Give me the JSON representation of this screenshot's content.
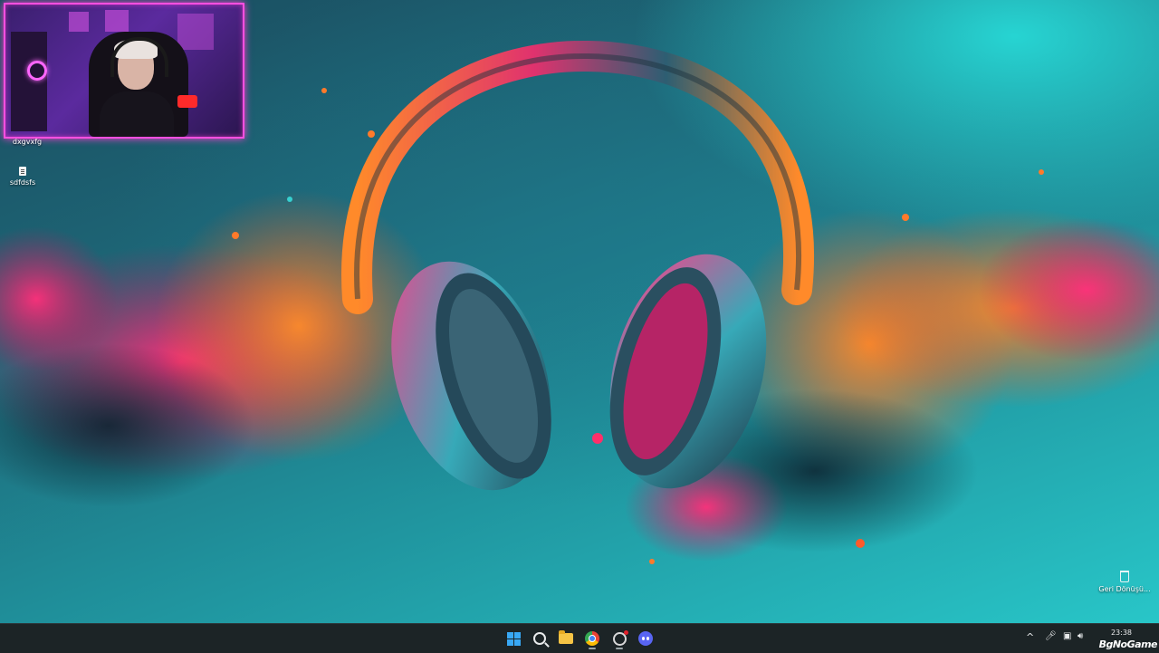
{
  "desktop": {
    "icons": [
      {
        "label": "dxgvxfg"
      },
      {
        "label": "sdfdsfs"
      }
    ],
    "recycle_bin": {
      "label": "Geri Dönüşü..."
    }
  },
  "taskbar": {
    "apps": [
      {
        "name": "start",
        "icon": "windows-icon"
      },
      {
        "name": "search",
        "icon": "search-icon"
      },
      {
        "name": "file-explorer",
        "icon": "folder-icon"
      },
      {
        "name": "chrome",
        "icon": "chrome-icon"
      },
      {
        "name": "obs",
        "icon": "obs-icon"
      },
      {
        "name": "discord",
        "icon": "discord-icon"
      }
    ],
    "tray": {
      "chevron": "^",
      "time": "23:38"
    },
    "watermark": "BgNoGame"
  },
  "colors": {
    "taskbar_bg": "#1c2426",
    "webcam_border": "#ff4fe0",
    "wallpaper_cyan": "#28c6c8"
  }
}
